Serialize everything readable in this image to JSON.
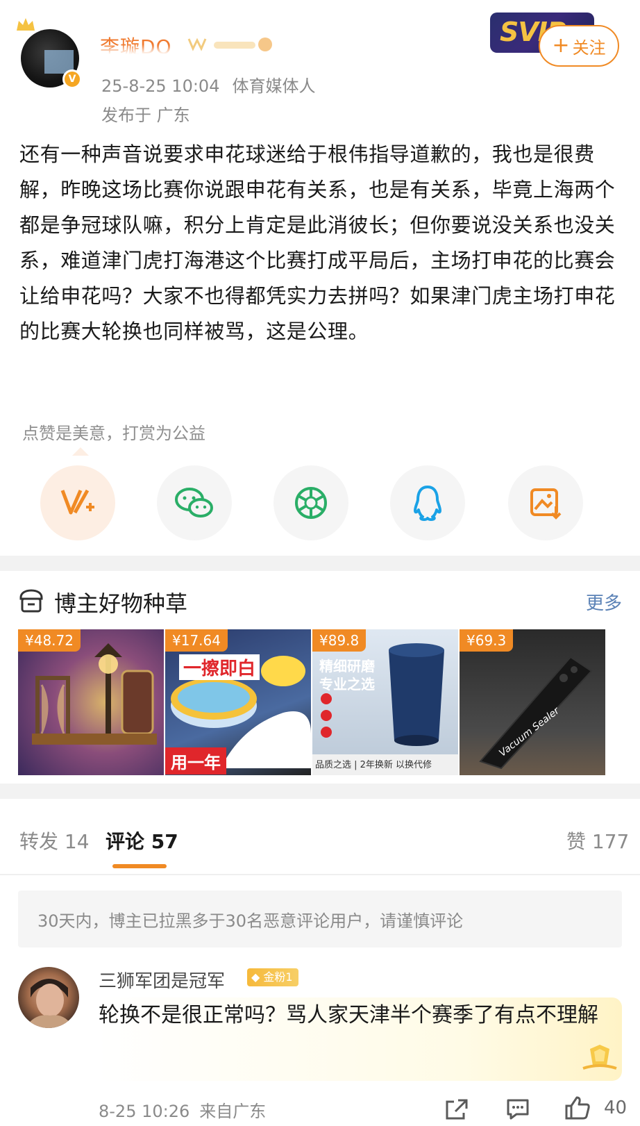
{
  "post": {
    "author": {
      "name": "李璇DQ",
      "verified_icon": "v-badge-icon",
      "crown_icon": "crown-icon"
    },
    "time": "25-8-25 10:04",
    "role": "体育媒体人",
    "location": "发布于 广东",
    "svip_label": "SVIP",
    "follow_label": "关注",
    "text": "还有一种声音说要求申花球迷给于根伟指导道歉的，我也是很费解，昨晚这场比赛你说跟申花有关系，也是有关系，毕竟上海两个都是争冠球队嘛，积分上肯定是此消彼长；但你要说没关系也没关系，难道津门虎打海港这个比赛打成平局后，主场打申花的比赛会让给申花吗？大家不也得都凭实力去拼吗？如果津门虎主场打申花的比赛大轮换也同样被骂，这是公理。",
    "reward_tip": "点赞是美意，打赏为公益"
  },
  "share": [
    {
      "name": "reward-v-plus-icon",
      "color": "#f08a24"
    },
    {
      "name": "wechat-icon",
      "color": "#2aae67"
    },
    {
      "name": "moments-icon",
      "color": "#2aae67"
    },
    {
      "name": "qq-icon",
      "color": "#1aa2e6"
    },
    {
      "name": "save-image-icon",
      "color": "#f08a24"
    }
  ],
  "goods": {
    "title": "博主好物种草",
    "more_label": "更多",
    "items": [
      {
        "price": "¥48.72",
        "overlay": ""
      },
      {
        "price": "¥17.64",
        "overlay": "一擦即白",
        "overlay2": "用一年"
      },
      {
        "price": "¥89.8",
        "overlay": "精细研磨\n专业之选",
        "overlay2": "品质之选 | 2年换新 以换代修"
      },
      {
        "price": "¥69.3",
        "overlay": "Vacuum Sealer"
      }
    ]
  },
  "tabs": {
    "repost": "转发 14",
    "comments": "评论 57",
    "likes": "赞 177"
  },
  "notice": "30天内，博主已拉黑多于30名恶意评论用户，请谨慎评论",
  "comment": {
    "user": "三狮军团是冠军",
    "fan_badge": "金粉1",
    "text": "轮换不是很正常吗？骂人家天津半个赛季了有点不理解",
    "time": "8-25 10:26",
    "location": "来自广东",
    "likes": "40"
  }
}
